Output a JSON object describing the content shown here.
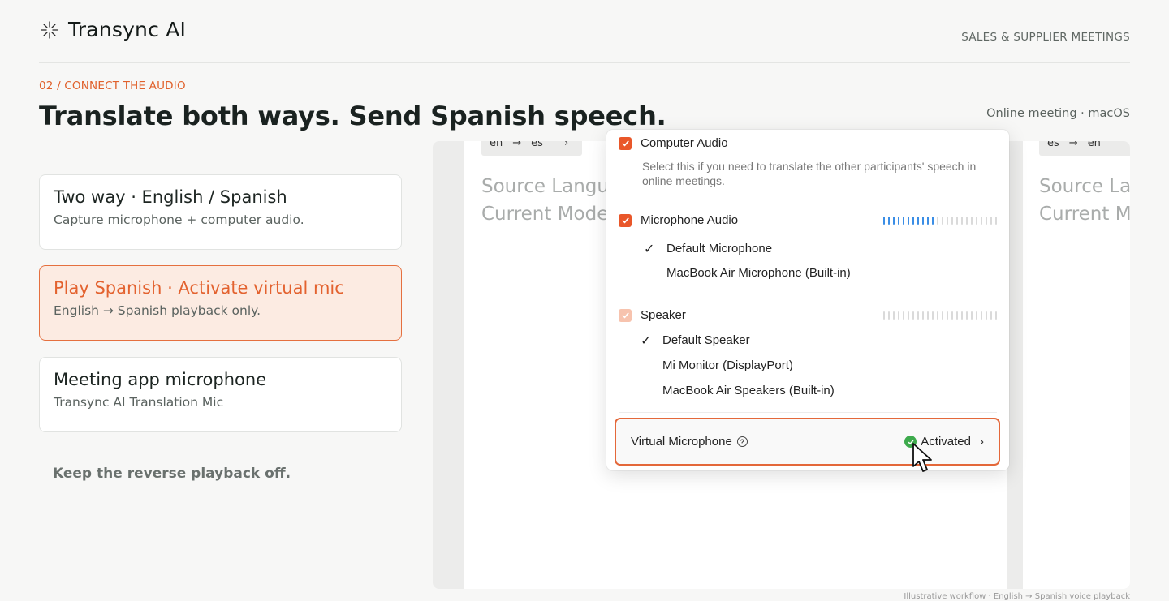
{
  "header": {
    "brand": "Transync AI",
    "section": "SALES & SUPPLIER MEETINGS"
  },
  "step": {
    "label": "02 / CONNECT THE AUDIO",
    "headline": "Translate both ways. Send Spanish speech.",
    "meta": "Online meeting · macOS"
  },
  "cards": [
    {
      "title": "Two way · English / Spanish",
      "subtitle": "Capture microphone + computer audio."
    },
    {
      "title": "Play Spanish · Activate virtual mic",
      "subtitle": "English → Spanish playback only."
    },
    {
      "title": "Meeting app microphone",
      "subtitle": "Transync AI Translation Mic"
    }
  ],
  "note": "Keep the reverse playback off.",
  "preview": {
    "left_pane": {
      "lang_from": "en",
      "lang_to": "es",
      "ghost_line1": "Source Langu",
      "ghost_line2": "Current Mode"
    },
    "right_pane": {
      "lang_from": "es",
      "lang_to": "en",
      "ghost_line1": "Source La",
      "ghost_line2": "Current M"
    }
  },
  "audio_menu": {
    "computer_audio": {
      "label": "Computer Audio",
      "description": "Select this if you need to translate the other participants' speech in online meetings.",
      "checked": true
    },
    "microphone_audio": {
      "label": "Microphone Audio",
      "checked": true,
      "level": 0.45,
      "devices": [
        "Default Microphone",
        "MacBook Air Microphone (Built-in)"
      ],
      "selected": "Default Microphone"
    },
    "speaker": {
      "label": "Speaker",
      "checked": true,
      "disabled": true,
      "level": 0,
      "devices": [
        "Default Speaker",
        "Mi Monitor (DisplayPort)",
        "MacBook Air Speakers (Built-in)"
      ],
      "selected": "Default Speaker"
    },
    "virtual_microphone": {
      "label": "Virtual Microphone",
      "status": "Activated"
    }
  },
  "caption": "Illustrative workflow · English → Spanish voice playback",
  "colors": {
    "accent": "#e3622f",
    "active_card_bg": "#fcebe2",
    "meter_on": "#3b8ee6",
    "status_ok": "#3daa4c"
  }
}
